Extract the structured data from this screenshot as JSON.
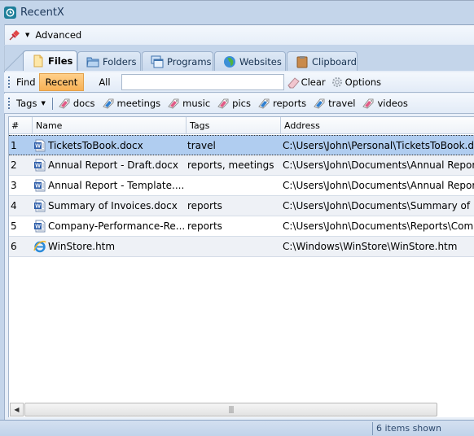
{
  "app": {
    "title": "RecentX",
    "advanced_label": "Advanced"
  },
  "tabs": [
    {
      "label": "Files",
      "icon": "file-icon",
      "active": true
    },
    {
      "label": "Folders",
      "icon": "folder-icon",
      "active": false
    },
    {
      "label": "Programs",
      "icon": "programs-icon",
      "active": false
    },
    {
      "label": "Websites",
      "icon": "globe-icon",
      "active": false
    },
    {
      "label": "Clipboard",
      "icon": "clipboard-icon",
      "active": false
    }
  ],
  "find_toolbar": {
    "find_label": "Find",
    "recent_label": "Recent",
    "all_label": "All",
    "search_value": "",
    "search_placeholder": "",
    "clear_label": "Clear",
    "options_label": "Options",
    "active_filter": "Recent"
  },
  "tags_toolbar": {
    "tags_label": "Tags",
    "tags": [
      {
        "label": "docs",
        "color": "#e05a86"
      },
      {
        "label": "meetings",
        "color": "#2f7fd0"
      },
      {
        "label": "music",
        "color": "#e05a86"
      },
      {
        "label": "pics",
        "color": "#e05a86"
      },
      {
        "label": "reports",
        "color": "#2f7fd0"
      },
      {
        "label": "travel",
        "color": "#2f7fd0"
      },
      {
        "label": "videos",
        "color": "#e05a86"
      }
    ]
  },
  "grid": {
    "columns": [
      "#",
      "Name",
      "Tags",
      "Address"
    ],
    "rows": [
      {
        "num": "1",
        "name": "TicketsToBook.docx",
        "tags": "travel",
        "address": "C:\\Users\\John\\Personal\\TicketsToBook.docx",
        "icon": "word-doc-icon",
        "selected": true
      },
      {
        "num": "2",
        "name": "Annual Report - Draft.docx",
        "tags": "reports, meetings",
        "address": "C:\\Users\\John\\Documents\\Annual Report - Draft.docx",
        "icon": "word-doc-icon",
        "selected": false
      },
      {
        "num": "3",
        "name": "Annual Report - Template....",
        "tags": "",
        "address": "C:\\Users\\John\\Documents\\Annual Report - Template.docx",
        "icon": "word-doc-icon",
        "selected": false
      },
      {
        "num": "4",
        "name": "Summary of Invoices.docx",
        "tags": "reports",
        "address": "C:\\Users\\John\\Documents\\Summary of Invoices.docx",
        "icon": "word-doc-icon",
        "selected": false
      },
      {
        "num": "5",
        "name": "Company-Performance-Re...",
        "tags": "reports",
        "address": "C:\\Users\\John\\Documents\\Reports\\Company-Performance-Report.docx",
        "icon": "word-doc-icon",
        "selected": false
      },
      {
        "num": "6",
        "name": "WinStore.htm",
        "tags": "",
        "address": "C:\\Windows\\WinStore\\WinStore.htm",
        "icon": "ie-icon",
        "selected": false
      }
    ]
  },
  "status": {
    "items_shown": "6 items shown"
  },
  "colors": {
    "accent_active_button": "#f7b155",
    "selection": "#b0cdf0",
    "frame": "#c4d5ea"
  }
}
